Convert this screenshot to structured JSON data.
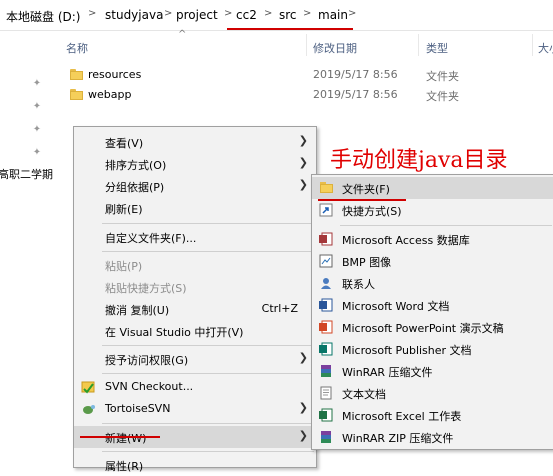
{
  "breadcrumb": {
    "items": [
      "本地磁盘 (D:)",
      "studyjava",
      "project",
      "cc2",
      "src",
      "main"
    ],
    "separator": ">"
  },
  "columns": {
    "name": "名称",
    "date": "修改日期",
    "type": "类型",
    "size": "大小"
  },
  "files": [
    {
      "name": "resources",
      "date": "2019/5/17 8:56",
      "type": "文件夹"
    },
    {
      "name": "webapp",
      "date": "2019/5/17 8:56",
      "type": "文件夹"
    }
  ],
  "left_pane": {
    "label": "高职二学期"
  },
  "context_menu": {
    "view": "查看(V)",
    "sort": "排序方式(O)",
    "group": "分组依据(P)",
    "refresh": "刷新(E)",
    "customize": "自定义文件夹(F)...",
    "paste": "粘贴(P)",
    "paste_shortcut": "粘贴快捷方式(S)",
    "undo_copy": "撤消 复制(U)",
    "undo_shortcut": "Ctrl+Z",
    "open_vs": "在 Visual Studio 中打开(V)",
    "grant_access": "授予访问权限(G)",
    "svn_checkout": "SVN Checkout...",
    "tortoise": "TortoiseSVN",
    "new": "新建(W)",
    "properties": "属性(R)"
  },
  "new_submenu": {
    "folder": "文件夹(F)",
    "shortcut": "快捷方式(S)",
    "access": "Microsoft Access 数据库",
    "bmp": "BMP 图像",
    "contact": "联系人",
    "word": "Microsoft Word 文档",
    "powerpoint": "Microsoft PowerPoint 演示文稿",
    "publisher": "Microsoft Publisher 文档",
    "winrar": "WinRAR 压缩文件",
    "text": "文本文档",
    "excel": "Microsoft Excel 工作表",
    "winrar_zip": "WinRAR ZIP 压缩文件"
  },
  "annotation": "手动创建java目录",
  "colors": {
    "annotation": "#e00000",
    "header_text": "#4d6082",
    "menu_bg": "#f2f2f2"
  }
}
